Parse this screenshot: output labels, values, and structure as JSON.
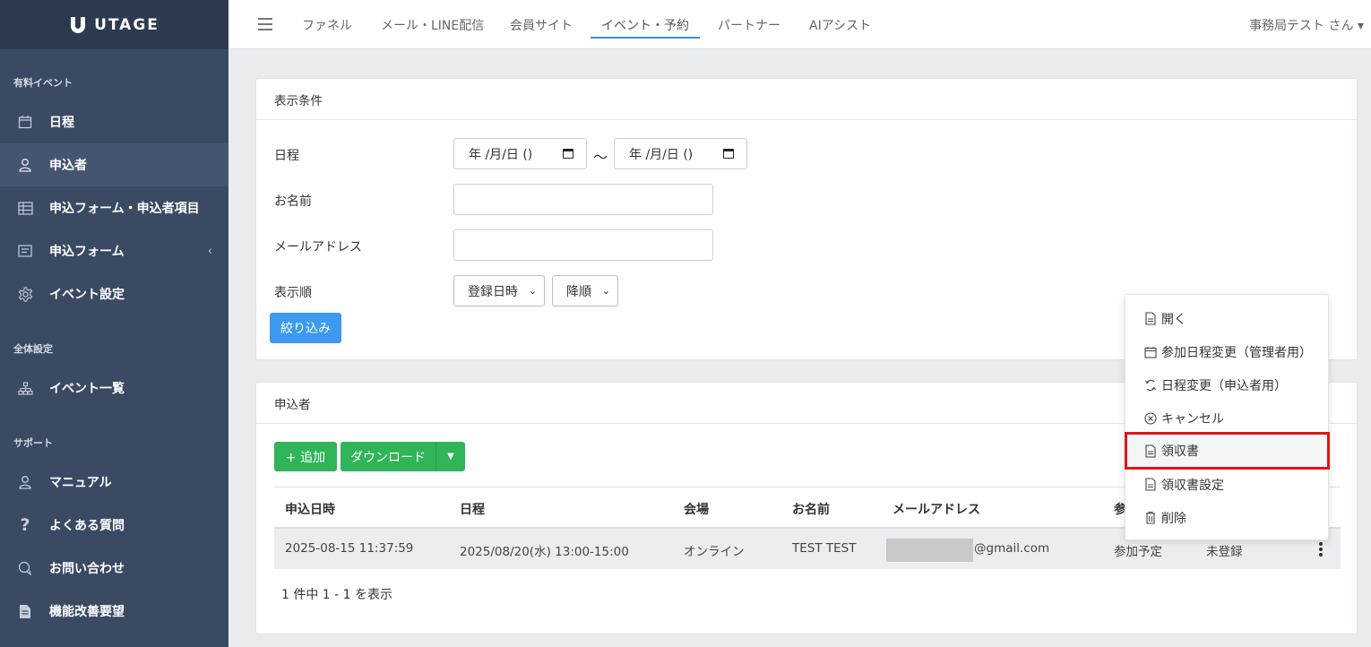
{
  "brand": {
    "name": "UTAGE"
  },
  "sidebar": {
    "sections": [
      {
        "label": "有料イベント"
      },
      {
        "label": "全体設定"
      },
      {
        "label": "サポート"
      }
    ],
    "items": [
      {
        "label": "日程",
        "icon": "calendar-icon"
      },
      {
        "label": "申込者",
        "icon": "user-icon",
        "active": true
      },
      {
        "label": "申込フォーム・申込者項目",
        "icon": "table-icon"
      },
      {
        "label": "申込フォーム",
        "icon": "form-icon",
        "caret": "‹"
      },
      {
        "label": "イベント設定",
        "icon": "gear-icon"
      },
      {
        "label": "イベント一覧",
        "icon": "sitemap-icon"
      },
      {
        "label": "マニュアル",
        "icon": "user-icon"
      },
      {
        "label": "よくある質問",
        "icon": "question-icon"
      },
      {
        "label": "お問い合わせ",
        "icon": "chat-icon"
      },
      {
        "label": "機能改善要望",
        "icon": "document-icon"
      }
    ]
  },
  "topnav": {
    "tabs": [
      {
        "label": "ファネル"
      },
      {
        "label": "メール・LINE配信"
      },
      {
        "label": "会員サイト"
      },
      {
        "label": "イベント・予約",
        "active": true
      },
      {
        "label": "パートナー"
      },
      {
        "label": "AIアシスト"
      }
    ],
    "user": "事務局テスト さん ▾"
  },
  "filter": {
    "title": "表示条件",
    "schedule_label": "日程",
    "date_from": "年 /月/日 ()",
    "date_to": "年 /月/日 ()",
    "range_separator": "～",
    "name_label": "お名前",
    "name_value": "",
    "email_label": "メールアドレス",
    "email_value": "",
    "order_label": "表示順",
    "order_by": "登録日時",
    "order_dir": "降順",
    "submit": "絞り込み"
  },
  "applicants": {
    "title": "申込者",
    "add_button": "+ 追加",
    "download_button": "ダウンロード",
    "columns": [
      "申込日時",
      "日程",
      "会場",
      "お名前",
      "メールアドレス",
      "参"
    ],
    "rows": [
      {
        "applied_at": "2025-08-15 11:37:59",
        "schedule": "2025/08/20(水) 13:00-15:00",
        "venue": "オンライン",
        "name": "TEST TEST",
        "email_suffix": "@gmail.com",
        "status": "参加予定",
        "registration": "未登録"
      }
    ],
    "summary": "1 件中 1 - 1 を表示"
  },
  "row_menu": {
    "items": [
      {
        "label": "開く",
        "icon": "file-icon"
      },
      {
        "label": "参加日程変更（管理者用）",
        "icon": "calendar-icon"
      },
      {
        "label": "日程変更（申込者用）",
        "icon": "refresh-icon"
      },
      {
        "label": "キャンセル",
        "icon": "cancel-circle-icon"
      },
      {
        "label": "領収書",
        "icon": "file-icon",
        "highlighted": true
      },
      {
        "label": "領収書設定",
        "icon": "file-icon"
      },
      {
        "label": "削除",
        "icon": "trash-icon"
      }
    ]
  },
  "colors": {
    "sidebar_bg": "#3b4a63",
    "accent_blue": "#3c9af0",
    "success_green": "#2fb457",
    "highlight_red": "#e1131b"
  }
}
